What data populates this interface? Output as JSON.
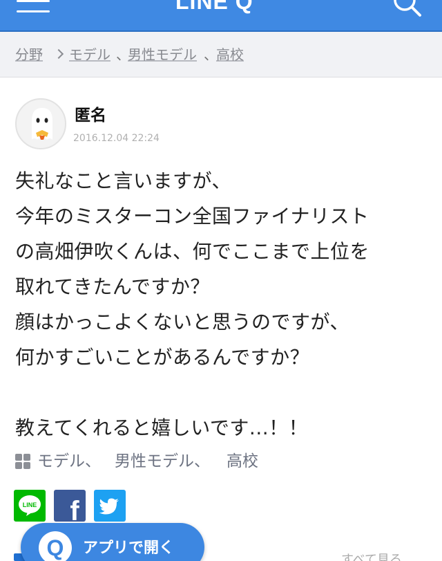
{
  "header": {
    "logo_text": "LINE Q",
    "bg_color": "#3f89e3"
  },
  "breadcrumb": {
    "items": [
      "分野",
      "モデル",
      "男性モデル",
      "高校"
    ],
    "separator": "、"
  },
  "question": {
    "author": "匿名",
    "timestamp": "2016.12.04 22:24",
    "body": "失礼なこと言いますが、\n今年のミスターコン全国ファイナリスト\nの高畑伊吹くんは、何でここまで上位を\n取れてきたんですか？\n顔はかっこよくないと思うのですが、\n何かすごいことがあるんですか？\n\n教えてくれると嬉しいです...！！"
  },
  "tags": [
    "モデル、",
    "男性モデル、",
    "高校"
  ],
  "share": {
    "line_label": "LINE",
    "facebook_glyph": "f"
  },
  "app_button": {
    "icon_letter": "Q",
    "label": "アプリで開く"
  },
  "footer": {
    "see_all_label": "すべて見る"
  },
  "icons": {
    "menu": "menu-icon",
    "search": "search-icon",
    "tags": "grid-icon"
  }
}
